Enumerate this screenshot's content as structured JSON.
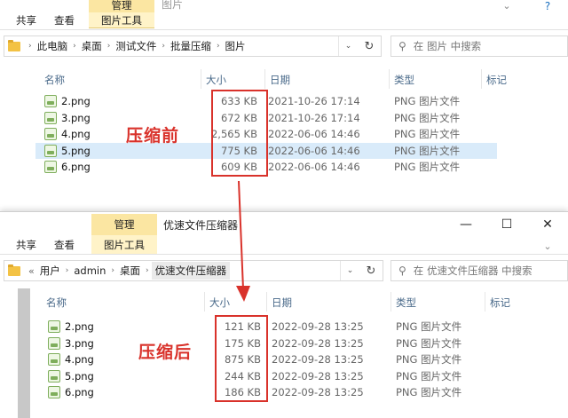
{
  "top": {
    "ribbon": {
      "share": "共享",
      "view": "查看",
      "ctx_group": "管理",
      "ctx_tab": "图片工具",
      "title": "图片"
    },
    "breadcrumb": [
      "此电脑",
      "桌面",
      "测试文件",
      "批量压缩",
      "图片"
    ],
    "search_placeholder": "在 图片 中搜索",
    "columns": {
      "name": "名称",
      "size": "大小",
      "date": "日期",
      "type": "类型",
      "tags": "标记"
    },
    "files": [
      {
        "name": "2.png",
        "size": "633 KB",
        "date": "2021-10-26 17:14",
        "type": "PNG 图片文件"
      },
      {
        "name": "3.png",
        "size": "672 KB",
        "date": "2021-10-26 17:14",
        "type": "PNG 图片文件"
      },
      {
        "name": "4.png",
        "size": "2,565 KB",
        "date": "2022-06-06 14:46",
        "type": "PNG 图片文件"
      },
      {
        "name": "5.png",
        "size": "775 KB",
        "date": "2022-06-06 14:46",
        "type": "PNG 图片文件"
      },
      {
        "name": "6.png",
        "size": "609 KB",
        "date": "2022-06-06 14:46",
        "type": "PNG 图片文件"
      }
    ],
    "annotation": "压缩前"
  },
  "bottom": {
    "ribbon": {
      "share": "共享",
      "view": "查看",
      "ctx_group": "管理",
      "ctx_tab": "图片工具",
      "title": "优速文件压缩器"
    },
    "breadcrumb_prefix": "«",
    "breadcrumb": [
      "用户",
      "admin",
      "桌面",
      "优速文件压缩器"
    ],
    "search_placeholder": "在 优速文件压缩器 中搜索",
    "columns": {
      "name": "名称",
      "size": "大小",
      "date": "日期",
      "type": "类型",
      "tags": "标记"
    },
    "files": [
      {
        "name": "2.png",
        "size": "121 KB",
        "date": "2022-09-28 13:25",
        "type": "PNG 图片文件"
      },
      {
        "name": "3.png",
        "size": "175 KB",
        "date": "2022-09-28 13:25",
        "type": "PNG 图片文件"
      },
      {
        "name": "4.png",
        "size": "875 KB",
        "date": "2022-09-28 13:25",
        "type": "PNG 图片文件"
      },
      {
        "name": "5.png",
        "size": "244 KB",
        "date": "2022-09-28 13:25",
        "type": "PNG 图片文件"
      },
      {
        "name": "6.png",
        "size": "186 KB",
        "date": "2022-09-28 13:25",
        "type": "PNG 图片文件"
      }
    ],
    "annotation": "压缩后"
  },
  "colors": {
    "annotation_red": "#d9322b",
    "selected_row": "#d9ebfa",
    "context_tab": "#fbe6a2"
  }
}
